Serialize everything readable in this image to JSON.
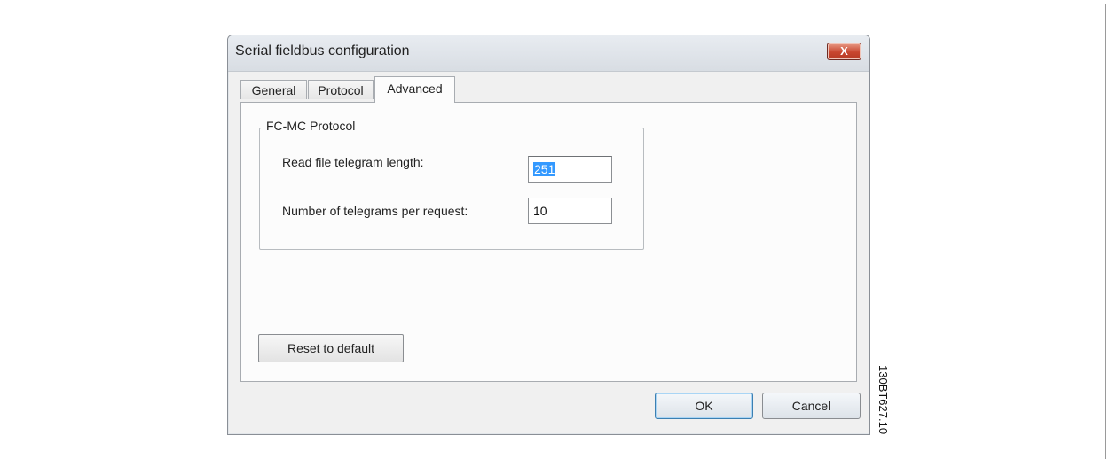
{
  "dialog": {
    "title": "Serial fieldbus configuration",
    "close_label": "X"
  },
  "tabs": [
    {
      "label": "General"
    },
    {
      "label": "Protocol"
    },
    {
      "label": "Advanced"
    }
  ],
  "group": {
    "title": "FC-MC Protocol",
    "fields": [
      {
        "label": "Read file telegram length:",
        "value": "251"
      },
      {
        "label": "Number of telegrams per request:",
        "value": "10"
      }
    ]
  },
  "buttons": {
    "reset": "Reset to default",
    "ok": "OK",
    "cancel": "Cancel"
  },
  "doc_code": "130BT627.10",
  "colors": {
    "selection": "#3399ff",
    "close_button": "#c8462f"
  }
}
